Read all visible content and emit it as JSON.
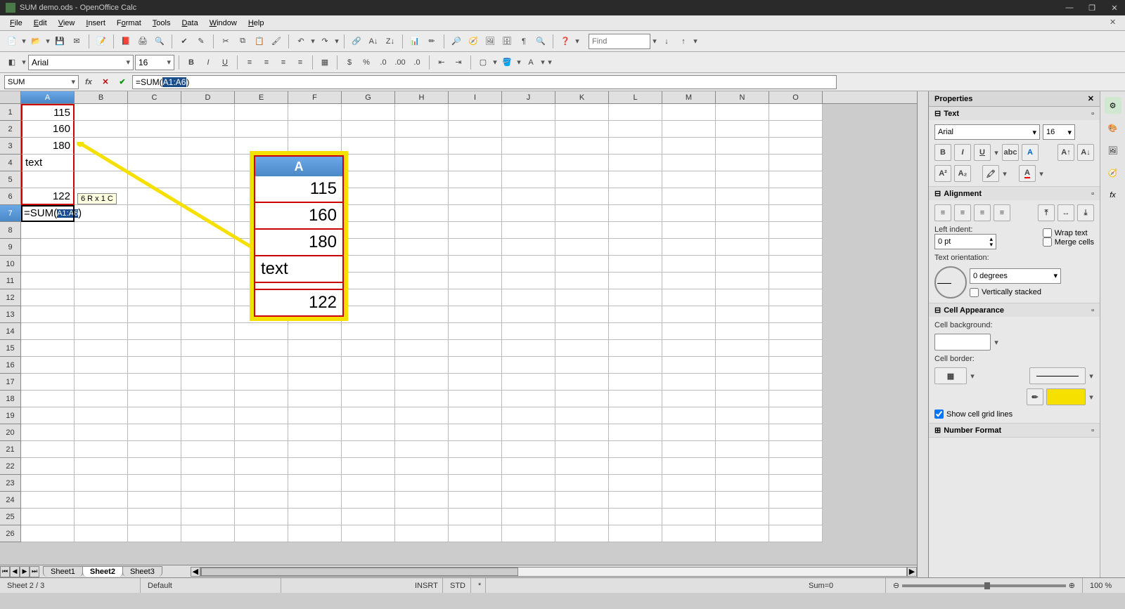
{
  "title": "SUM demo.ods - OpenOffice Calc",
  "menu": [
    "File",
    "Edit",
    "View",
    "Insert",
    "Format",
    "Tools",
    "Data",
    "Window",
    "Help"
  ],
  "find_placeholder": "Find",
  "font_name": "Arial",
  "font_size": "16",
  "name_box": "SUM",
  "formula": {
    "prefix": "=SUM(",
    "range": "A1:A6",
    "suffix": ")"
  },
  "columns": [
    "A",
    "B",
    "C",
    "D",
    "E",
    "F",
    "G",
    "H",
    "I",
    "J",
    "K",
    "L",
    "M",
    "N",
    "O"
  ],
  "rows": 26,
  "cells": {
    "A1": "115",
    "A2": "160",
    "A3": "180",
    "A4": "text",
    "A5": "",
    "A6": "122",
    "A7": "=SUM(A1:A6)"
  },
  "selection_tooltip": "6 R x 1 C",
  "sheet_tabs": [
    "Sheet1",
    "Sheet2",
    "Sheet3"
  ],
  "active_sheet": "Sheet2",
  "status": {
    "sheet": "Sheet 2 / 3",
    "style": "Default",
    "insert": "INSRT",
    "std": "STD",
    "sum": "Sum=0",
    "zoom": "100 %"
  },
  "zoomed": {
    "header": "A",
    "cells": [
      "115",
      "160",
      "180",
      "text",
      "",
      "122"
    ]
  },
  "props": {
    "title": "Properties",
    "text_section": "Text",
    "font": "Arial",
    "size": "16",
    "alignment_section": "Alignment",
    "left_indent_label": "Left indent:",
    "left_indent_value": "0 pt",
    "wrap": "Wrap text",
    "merge": "Merge cells",
    "orientation_label": "Text orientation:",
    "orientation_value": "0 degrees",
    "vert_stacked": "Vertically stacked",
    "appearance_section": "Cell Appearance",
    "bg_label": "Cell background:",
    "border_label": "Cell border:",
    "show_grid": "Show cell grid lines",
    "number_section": "Number Format"
  }
}
